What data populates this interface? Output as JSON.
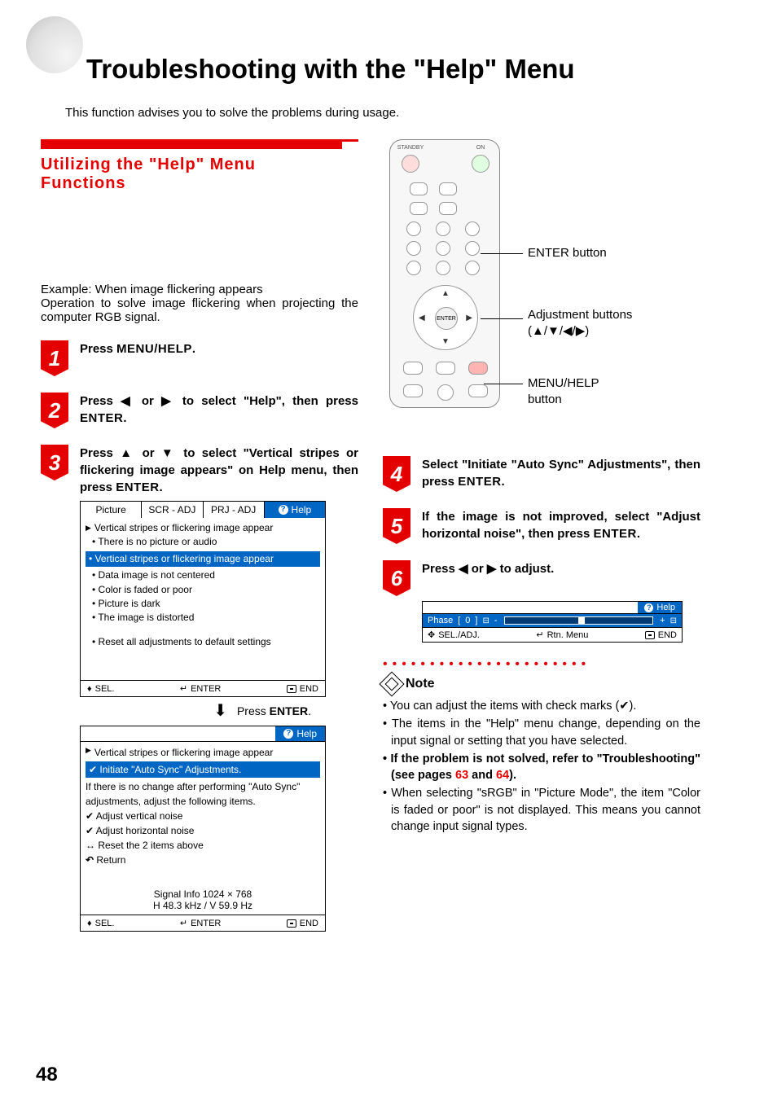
{
  "page_number": "48",
  "title": "Troubleshooting with the \"Help\" Menu",
  "intro": "This function advises you to solve the problems during usage.",
  "section_heading_line1": "Utilizing the \"Help\" Menu",
  "section_heading_line2": "Functions",
  "example_label": "Example: When image flickering appears",
  "example_body": "Operation to solve image flickering when projecting the computer RGB signal.",
  "steps_left": {
    "1": {
      "prefix": "Press ",
      "kw": "MENU/HELP",
      "suffix": "."
    },
    "2": {
      "text": "Press ◀ or ▶ to select \"Help\", then press ",
      "kw": "ENTER",
      "suffix": "."
    },
    "3": {
      "text": "Press ▲ or ▼ to select \"Vertical stripes or flickering image appears\" on Help menu, then press ",
      "kw": "ENTER",
      "suffix": "."
    }
  },
  "panel1": {
    "tabs": [
      "Picture",
      "SCR - ADJ",
      "PRJ - ADJ"
    ],
    "help_tab": "Help",
    "header": "Vertical stripes or flickering image appear",
    "items": [
      "There is no picture or audio",
      "Vertical stripes or flickering image appear",
      "Data image is not centered",
      "Color is faded or poor",
      "Picture is dark",
      "The image is distorted",
      "Reset all adjustments to default settings"
    ],
    "highlight_index": 1,
    "footer": {
      "sel": "SEL.",
      "enter": "ENTER",
      "end": "END"
    }
  },
  "press_enter_line": "Press ",
  "press_enter_kw": "ENTER",
  "panel2": {
    "help_tab": "Help",
    "header": "Vertical stripes or flickering image appear",
    "highlight": "Initiate \"Auto Sync\" Adjustments.",
    "post_text": "If there is no change after performing \"Auto Sync\" adjustments, adjust the following items.",
    "items": [
      "Adjust vertical noise",
      "Adjust horizontal noise",
      "Reset the 2 items above",
      "Return"
    ],
    "signal1": "Signal Info      1024 × 768",
    "signal2": "H        48.3  kHz  /  V   59.9  Hz",
    "footer": {
      "sel": "SEL.",
      "enter": "ENTER",
      "end": "END"
    }
  },
  "remote_callouts": {
    "enter": "ENTER button",
    "adj_line1": "Adjustment buttons",
    "adj_line2": "(▲/▼/◀/▶)",
    "menu_line1": "MENU/HELP",
    "menu_line2": "button"
  },
  "steps_right": {
    "4": {
      "text": "Select \"Initiate \"Auto Sync\" Adjustments\", then press ",
      "kw": "ENTER",
      "suffix": "."
    },
    "5": {
      "text": "If the image is not improved, select \"Adjust horizontal noise\", then press ",
      "kw": "ENTER",
      "suffix": "."
    },
    "6": {
      "text": "Press ◀ or ▶ to adjust."
    }
  },
  "adj_box": {
    "help_tab": "Help",
    "label": "Phase",
    "value_left": "[",
    "value_num": "0",
    "value_right": "]",
    "foot": {
      "sel": "SEL./ADJ.",
      "rtn": "Rtn. Menu",
      "end": "END"
    }
  },
  "note_label": "Note",
  "notes": [
    {
      "text": "You can adjust the items with check marks (✔)."
    },
    {
      "text": "The items in the \"Help\" menu change, depending on the input signal or setting that you have selected."
    },
    {
      "bold": true,
      "text_pre": "If the problem is not solved, refer to \"Troubleshooting\" (see pages ",
      "pg1": "63",
      "mid": " and ",
      "pg2": "64",
      "text_post": ")."
    },
    {
      "text": "When selecting \"sRGB\" in \"Picture Mode\", the item \"Color is faded or poor\" is not displayed. This means you cannot change input signal types."
    }
  ]
}
